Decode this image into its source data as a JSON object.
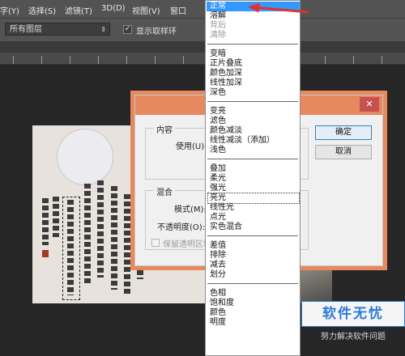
{
  "menubar": {
    "items": [
      "字(Y)",
      "选择(S)",
      "滤镜(T)",
      "3D(D)",
      "视图(V)",
      "窗口"
    ]
  },
  "options_bar": {
    "layers_select": "所有图层",
    "show_ring_checked": true,
    "show_ring_label": "显示取样环"
  },
  "dialog": {
    "content_group": "内容",
    "use_label": "使用(U):",
    "blend_group": "混合",
    "mode_label": "模式(M):",
    "opacity_label": "不透明度(O):",
    "preserve_label": "保留透明区域",
    "ok_button": "确定",
    "cancel_button": "取消"
  },
  "blend_dropdown": {
    "selected": "正常",
    "focused": "亮光",
    "groups": [
      [
        "正常",
        "溶解",
        "背后",
        "清除"
      ],
      [
        "变暗",
        "正片叠底",
        "颜色加深",
        "线性加深",
        "深色"
      ],
      [
        "变亮",
        "滤色",
        "颜色减淡",
        "线性减淡（添加）",
        "浅色"
      ],
      [
        "叠加",
        "柔光",
        "强光",
        "亮光",
        "线性光",
        "点光",
        "实色混合"
      ],
      [
        "差值",
        "排除",
        "减去",
        "划分"
      ],
      [
        "色相",
        "饱和度",
        "颜色",
        "明度"
      ]
    ],
    "disabled": [
      "背后",
      "清除"
    ]
  },
  "watermark": {
    "logo": "软件无忧",
    "subtitle": "努力解决软件问题"
  },
  "colors": {
    "accent_selected": "#3399ff",
    "dialog_title": "#e8885f",
    "annotation_arrow": "#e53030"
  }
}
